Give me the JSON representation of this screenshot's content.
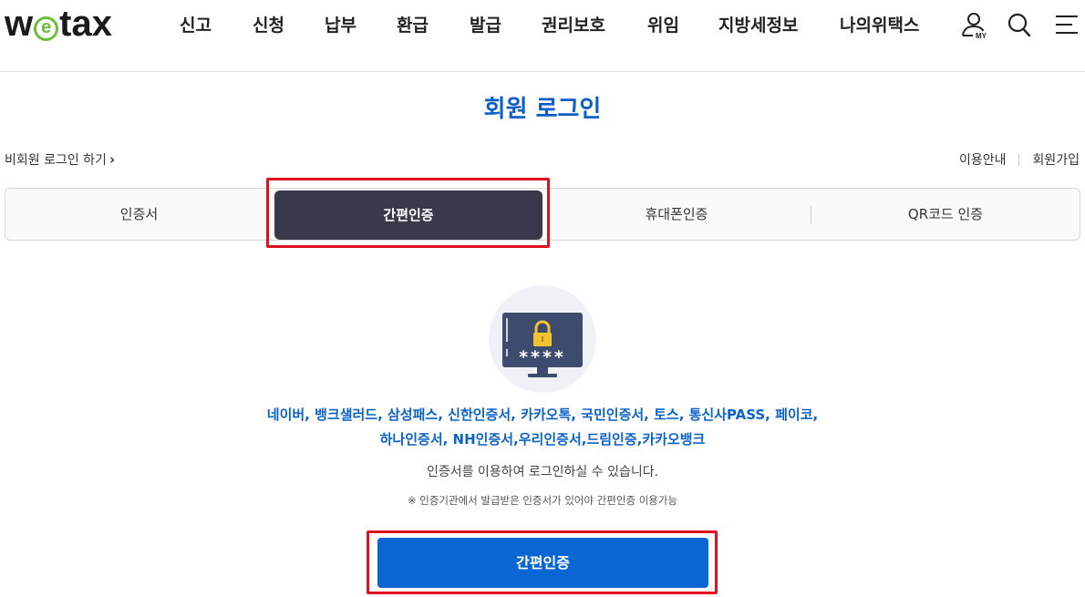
{
  "header": {
    "logo_text_before": "w",
    "logo_e": "e",
    "logo_text_after": "tax",
    "nav": [
      "신고",
      "신청",
      "납부",
      "환급",
      "발급",
      "권리보호",
      "위임",
      "지방세정보",
      "나의위택스"
    ],
    "icons": {
      "my": "user-my-icon",
      "search": "search-icon",
      "menu": "hamburger-menu-icon"
    },
    "my_label": "MY"
  },
  "page": {
    "title": "회원 로그인",
    "nonmember_link": "비회원 로그인 하기",
    "util_links": [
      "이용안내",
      "회원가입"
    ]
  },
  "tabs": [
    {
      "label": "인증서",
      "active": false
    },
    {
      "label": "간편인증",
      "active": true
    },
    {
      "label": "휴대폰인증",
      "active": false
    },
    {
      "label": "QR코드 인증",
      "active": false
    }
  ],
  "content": {
    "illustration": "monitor-lock-password-icon",
    "password_mask": "****",
    "providers_line1": "네이버, 뱅크샐러드, 삼성패스, 신한인증서, 카카오톡, 국민인증서, 토스, 통신사PASS, 페이코,",
    "providers_line2": "하나인증서, NH인증서,우리인증서,드림인증,카카오뱅크",
    "description": "인증서를 이용하여 로그인하실 수 있습니다.",
    "note": "※ 인증기관에서 발급받은 인증서가 있어야 간편인증 이용가능",
    "button_label": "간편인증"
  },
  "colors": {
    "primary": "#0a66d2",
    "title_blue": "#0b5fc7",
    "active_tab": "#383a4b",
    "highlight": "#e0101f",
    "logo_green": "#6bbf3a"
  }
}
